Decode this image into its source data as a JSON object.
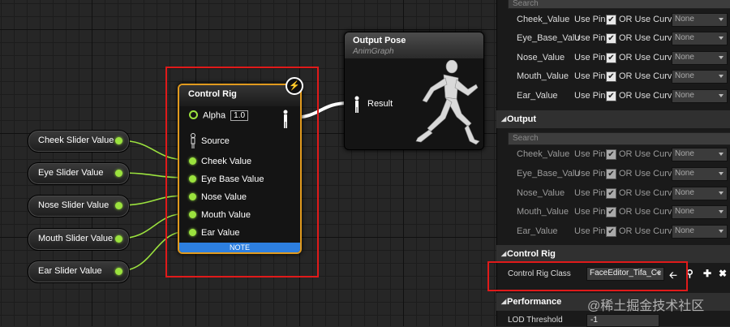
{
  "graph": {
    "variables": [
      {
        "label": "Cheek Slider Value"
      },
      {
        "label": "Eye Slider Value"
      },
      {
        "label": "Nose Slider Value"
      },
      {
        "label": "Mouth Slider Value"
      },
      {
        "label": "Ear Slider Value"
      }
    ],
    "control_rig_node": {
      "title": "Control Rig",
      "alpha_label": "Alpha",
      "alpha_value": "1.0",
      "source_label": "Source",
      "inputs": [
        "Cheek Value",
        "Eye Base Value",
        "Nose Value",
        "Mouth Value",
        "Ear Value"
      ],
      "note": "NOTE"
    },
    "output_node": {
      "title": "Output Pose",
      "subtitle": "AnimGraph",
      "result_label": "Result"
    }
  },
  "panel": {
    "top_search_placeholder": "Search",
    "input_rows": [
      {
        "name": "Cheek_Value",
        "use_pin": "Use Pin",
        "or_curve": "OR Use Curve",
        "curve": "None"
      },
      {
        "name": "Eye_Base_Valu",
        "use_pin": "Use Pin",
        "or_curve": "OR Use Curve",
        "curve": "None"
      },
      {
        "name": "Nose_Value",
        "use_pin": "Use Pin",
        "or_curve": "OR Use Curve",
        "curve": "None"
      },
      {
        "name": "Mouth_Value",
        "use_pin": "Use Pin",
        "or_curve": "OR Use Curve",
        "curve": "None"
      },
      {
        "name": "Ear_Value",
        "use_pin": "Use Pin",
        "or_curve": "OR Use Curve",
        "curve": "None"
      }
    ],
    "output_section": "Output",
    "output_search_placeholder": "Search",
    "output_rows": [
      {
        "name": "Cheek_Value",
        "use_pin": "Use Pin",
        "or_curve": "OR Use Curve",
        "curve": "None"
      },
      {
        "name": "Eye_Base_Valu",
        "use_pin": "Use Pin",
        "or_curve": "OR Use Curve",
        "curve": "None"
      },
      {
        "name": "Nose_Value",
        "use_pin": "Use Pin",
        "or_curve": "OR Use Curve",
        "curve": "None"
      },
      {
        "name": "Mouth_Value",
        "use_pin": "Use Pin",
        "or_curve": "OR Use Curve",
        "curve": "None"
      },
      {
        "name": "Ear_Value",
        "use_pin": "Use Pin",
        "or_curve": "OR Use Curve",
        "curve": "None"
      }
    ],
    "control_rig_section": "Control Rig",
    "control_rig_class_label": "Control Rig Class",
    "control_rig_class_value": "FaceEditor_Tifa_Cc",
    "performance_section": "Performance",
    "lod_label": "LOD Threshold",
    "lod_value": "-1"
  },
  "watermark": "@稀土掘金技术社区",
  "colors": {
    "pin": "#9be23e",
    "highlight": "#e01a1a",
    "node_border": "#e19a1e",
    "note": "#2d7fe0"
  }
}
